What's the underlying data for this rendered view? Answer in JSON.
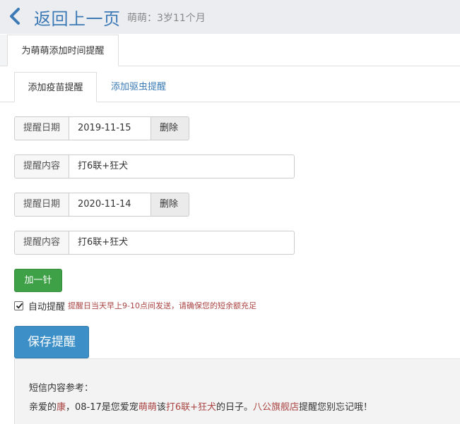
{
  "header": {
    "back_title": "返回上一页",
    "baby_info": "萌萌：3岁11个月"
  },
  "page_tab": {
    "label": "为萌萌添加时间提醒"
  },
  "sub_tabs": [
    {
      "label": "添加疫苗提醒"
    },
    {
      "label": "添加驱虫提醒"
    }
  ],
  "reminders": [
    {
      "date_label": "提醒日期",
      "date": "2019-11-15",
      "delete_label": "删除",
      "content_label": "提醒内容",
      "content": "打6联+狂犬"
    },
    {
      "date_label": "提醒日期",
      "date": "2020-11-14",
      "delete_label": "删除",
      "content_label": "提醒内容",
      "content": "打6联+狂犬"
    }
  ],
  "add_button": "加一针",
  "auto_remind": {
    "checked": true,
    "label": "自动提醒",
    "note": "提醒日当天早上9-10点间发送，请确保您的短余额充足"
  },
  "save_button": "保存提醒",
  "sms_preview": {
    "title": "短信内容参考：",
    "parts": [
      "亲爱的",
      "康",
      "，08-17是您爱宠",
      "萌萌",
      "该",
      "打6联+狂犬",
      "的日子。",
      "八公旗舰店",
      "提醒您别忘记哦！"
    ]
  },
  "colors": {
    "accent": "#3c7ab5",
    "success": "#3fa147",
    "primary": "#3c8fc7",
    "warning_text": "#a94442"
  }
}
